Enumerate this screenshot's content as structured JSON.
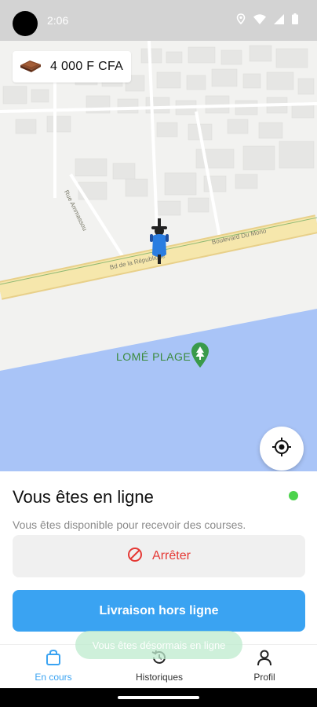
{
  "status_bar": {
    "time": "2:06",
    "icons": [
      "location-icon",
      "wifi-icon",
      "signal-icon",
      "battery-icon"
    ]
  },
  "map": {
    "balance": "4 000 F CFA",
    "road_labels": [
      "Bd de la République",
      "Boulevard Du Mono",
      "Rue Ammassou"
    ],
    "place_label": "LOMÉ PLAGE",
    "colors": {
      "road": "#f3e3a3",
      "sea": "#a9c4f7",
      "place": "#3a8a3a"
    }
  },
  "sheet": {
    "title": "Vous êtes en ligne",
    "description": "Vous êtes disponible pour recevoir des courses.",
    "stop_label": "Arrêter",
    "offline_label": "Livraison hors ligne",
    "toast": "Vous êtes désormais en ligne"
  },
  "nav": {
    "items": [
      {
        "label": "En cours",
        "icon": "bag-icon",
        "active": true
      },
      {
        "label": "Historiques",
        "icon": "history-icon",
        "active": false
      },
      {
        "label": "Profil",
        "icon": "profile-icon",
        "active": false
      }
    ],
    "colors": {
      "active": "#3aa3f2",
      "inactive": "#333333"
    }
  }
}
